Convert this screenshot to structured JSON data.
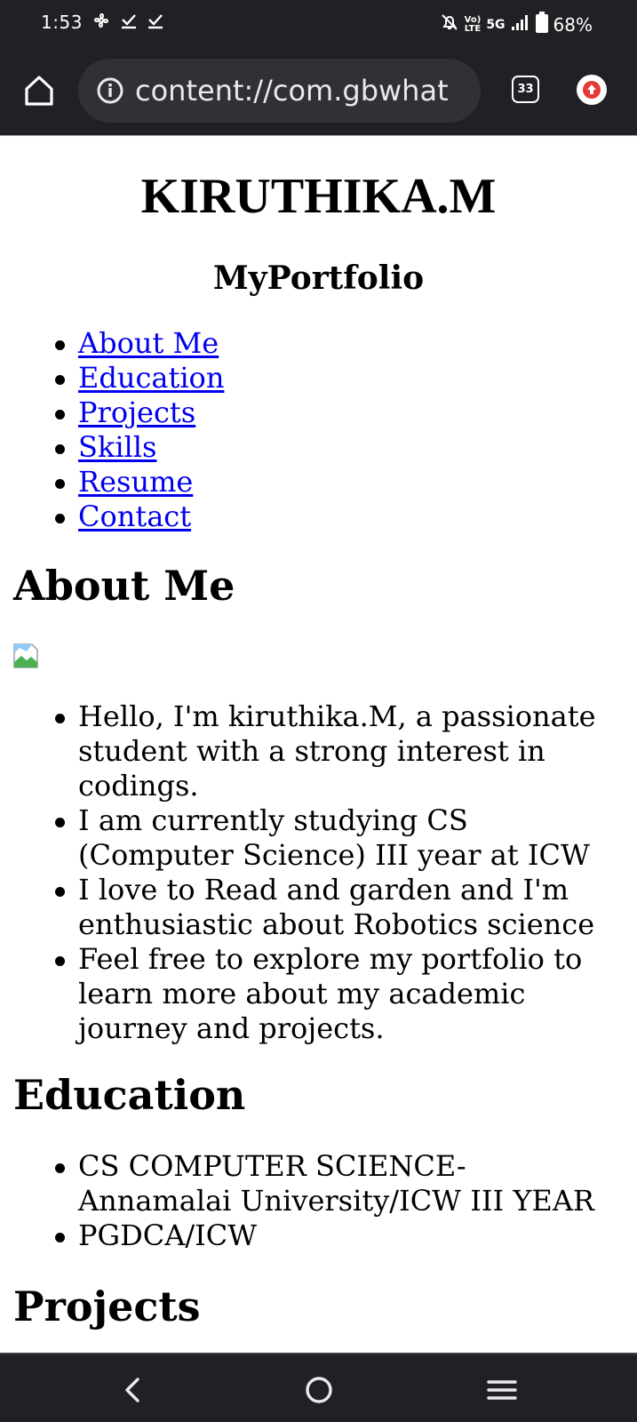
{
  "status_bar": {
    "time": "1:53",
    "network": "5G",
    "volte": "VoLTE",
    "battery": "68%"
  },
  "browser": {
    "url": "content://com.gbwhat",
    "tab_count": "33"
  },
  "page": {
    "title": "KIRUTHIKA.M",
    "subtitle": "MyPortfolio",
    "nav_links": [
      {
        "label": "About Me"
      },
      {
        "label": "Education"
      },
      {
        "label": "Projects"
      },
      {
        "label": "Skills"
      },
      {
        "label": "Resume"
      },
      {
        "label": "Contact"
      }
    ],
    "about": {
      "heading": "About Me",
      "items": [
        "Hello, I'm kiruthika.M, a passionate student with a strong interest in codings.",
        "I am currently studying CS (Computer Science) III year at ICW",
        "I love to Read and garden and I'm enthusiastic about Robotics science",
        "Feel free to explore my portfolio to learn more about my academic journey and projects."
      ]
    },
    "education": {
      "heading": "Education",
      "items": [
        "CS COMPUTER SCIENCE- Annamalai University/ICW III YEAR",
        "PGDCA/ICW"
      ]
    },
    "projects": {
      "heading": "Projects"
    }
  },
  "colors": {
    "system_bar": "#202124",
    "url_pill": "#303134",
    "link": "#0000ee",
    "upload_arrow": "#e53935"
  }
}
